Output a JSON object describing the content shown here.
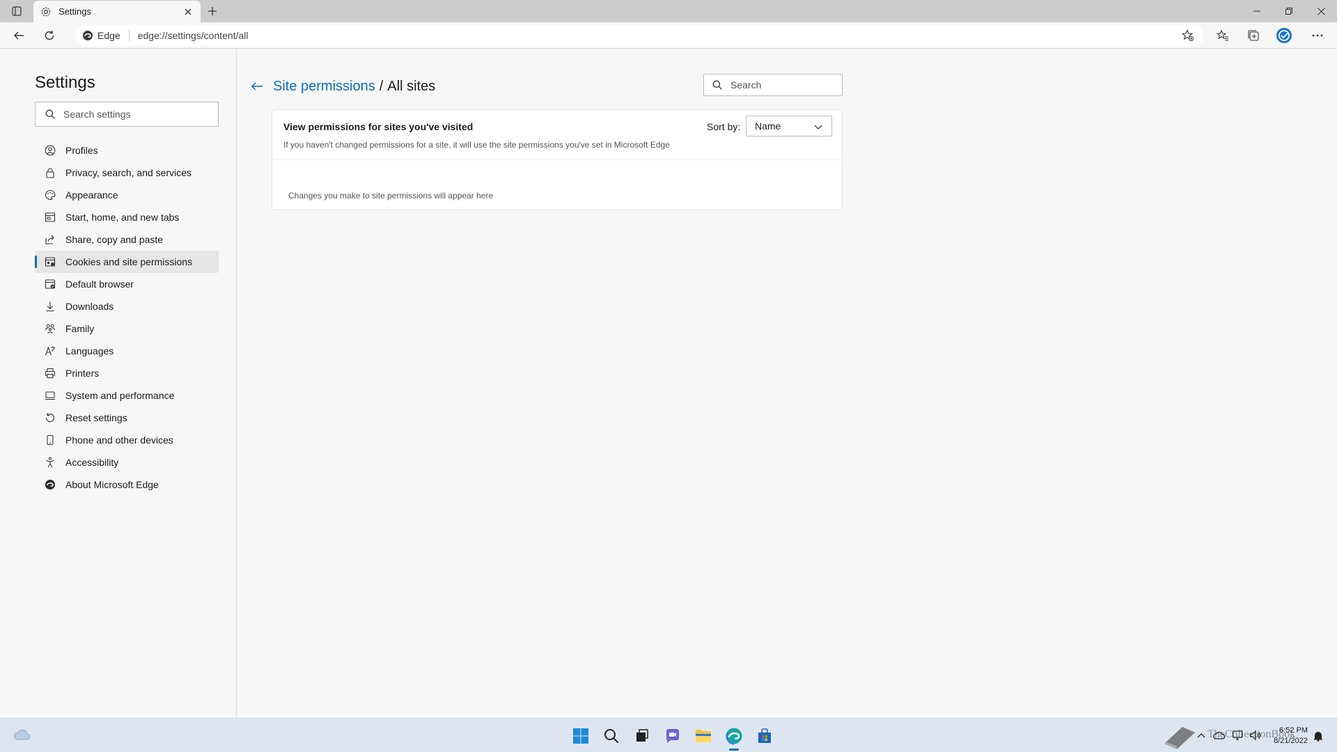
{
  "browser": {
    "tab": {
      "title": "Settings"
    },
    "address": {
      "site_label": "Edge",
      "url": "edge://settings/content/all"
    }
  },
  "sidebar": {
    "title": "Settings",
    "search_placeholder": "Search settings",
    "items": [
      {
        "label": "Profiles",
        "icon": "profile-icon"
      },
      {
        "label": "Privacy, search, and services",
        "icon": "lock-icon"
      },
      {
        "label": "Appearance",
        "icon": "appearance-icon"
      },
      {
        "label": "Start, home, and new tabs",
        "icon": "home-icon"
      },
      {
        "label": "Share, copy and paste",
        "icon": "share-icon"
      },
      {
        "label": "Cookies and site permissions",
        "icon": "cookies-icon",
        "active": true
      },
      {
        "label": "Default browser",
        "icon": "browser-icon"
      },
      {
        "label": "Downloads",
        "icon": "download-icon"
      },
      {
        "label": "Family",
        "icon": "family-icon"
      },
      {
        "label": "Languages",
        "icon": "languages-icon"
      },
      {
        "label": "Printers",
        "icon": "printer-icon"
      },
      {
        "label": "System and performance",
        "icon": "system-icon"
      },
      {
        "label": "Reset settings",
        "icon": "reset-icon"
      },
      {
        "label": "Phone and other devices",
        "icon": "phone-icon"
      },
      {
        "label": "Accessibility",
        "icon": "accessibility-icon"
      },
      {
        "label": "About Microsoft Edge",
        "icon": "edge-icon"
      }
    ]
  },
  "main": {
    "breadcrumb": {
      "parent": "Site permissions",
      "separator": "/",
      "current": "All sites"
    },
    "search_placeholder": "Search",
    "card": {
      "title": "View permissions for sites you've visited",
      "description": "If you haven't changed permissions for a site, it will use the site permissions you've set in Microsoft Edge",
      "sort_label": "Sort by:",
      "sort_value": "Name",
      "empty_message": "Changes you make to site permissions will appear here"
    }
  },
  "taskbar": {
    "apps": [
      "start-icon",
      "search-icon",
      "task-view-icon",
      "chat-icon",
      "file-explorer-icon",
      "edge-icon",
      "store-icon"
    ],
    "clock": {
      "time": "6:52 PM",
      "date": "8/21/2022"
    },
    "watermark": "TheCollectionBook"
  },
  "colors": {
    "accent": "#0f6cbd",
    "taskbar": "#dde6f0",
    "chrome": "#cccccc"
  }
}
